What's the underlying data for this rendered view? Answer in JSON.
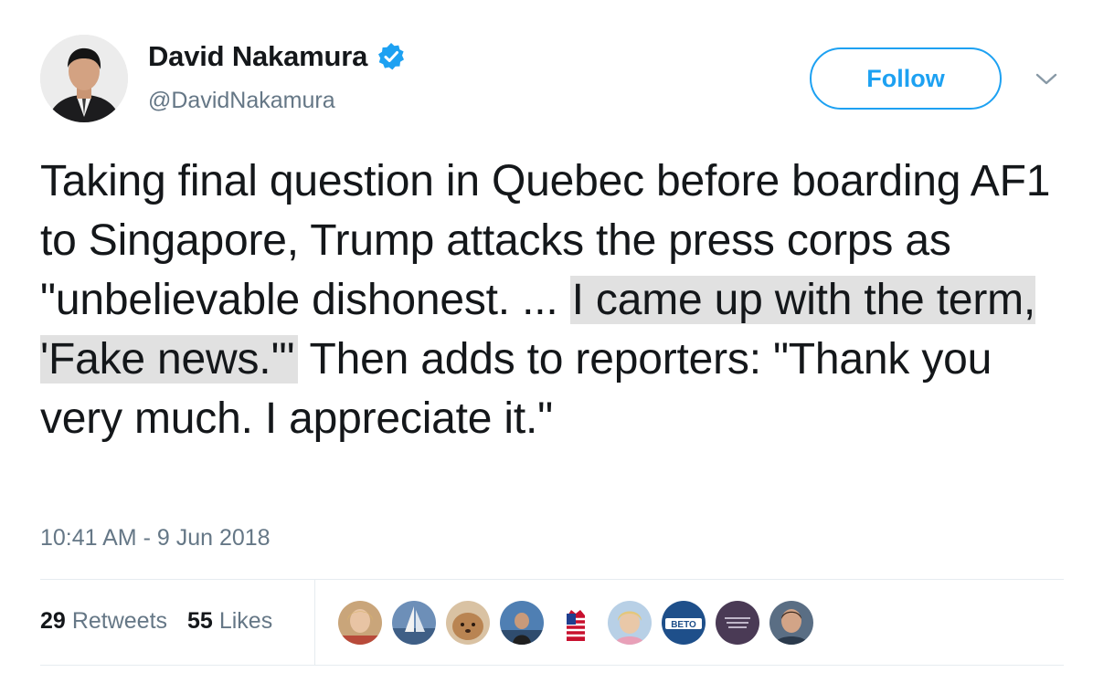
{
  "author": {
    "display_name": "David Nakamura",
    "handle": "@DavidNakamura",
    "verified_icon": "verified-badge-icon"
  },
  "actions": {
    "follow_label": "Follow",
    "more_icon": "chevron-down-icon"
  },
  "tweet": {
    "text_before": "Taking final question in Quebec before boarding AF1 to Singapore, Trump attacks the press corps as \"unbelievable dishonest. ... ",
    "text_highlighted": "I came up with the term, 'Fake news.'\"",
    "text_after": " Then adds to reporters: \"Thank you very much. I appreciate it.\"",
    "timestamp": "10:41 AM - 9 Jun 2018"
  },
  "stats": {
    "retweets_count": "29",
    "retweets_label": "Retweets",
    "likes_count": "55",
    "likes_label": "Likes"
  },
  "likers": [
    {
      "name": "liker-avatar-1"
    },
    {
      "name": "liker-avatar-2"
    },
    {
      "name": "liker-avatar-3"
    },
    {
      "name": "liker-avatar-4"
    },
    {
      "name": "liker-avatar-5"
    },
    {
      "name": "liker-avatar-6"
    },
    {
      "name": "liker-avatar-7",
      "text": "BETO"
    },
    {
      "name": "liker-avatar-8"
    },
    {
      "name": "liker-avatar-9"
    }
  ],
  "colors": {
    "brand_blue": "#1da1f2",
    "text": "#14171a",
    "secondary": "#657786",
    "highlight": "#e1e1e1"
  }
}
